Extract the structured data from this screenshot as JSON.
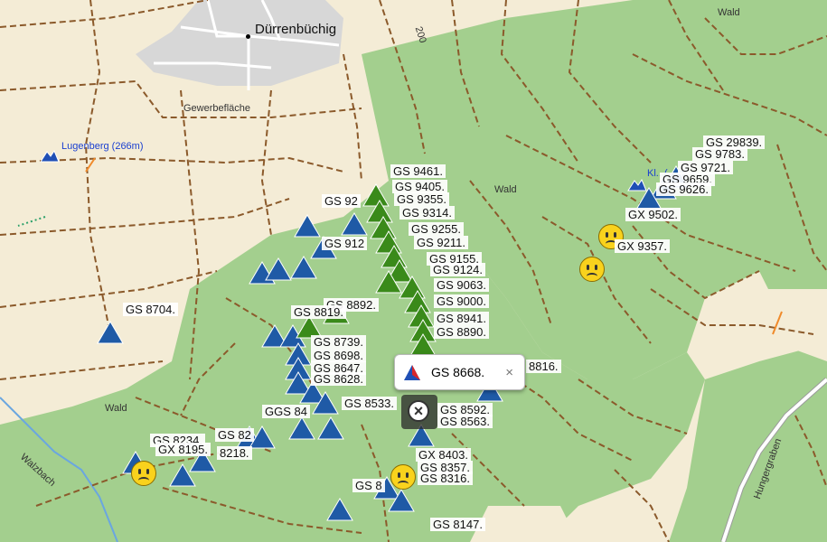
{
  "map": {
    "places": {
      "village": "Dürrenbüchig",
      "industrial": "Gewerbefläche",
      "wald_1": "Wald",
      "wald_2": "Wald",
      "wald_3": "Wald",
      "stream": "Walzbach",
      "road": "Hungergraben",
      "contour": "200",
      "peak": "Lugenberg (266m)",
      "peak2": "Kl...(...m)"
    },
    "labels": {
      "gs9461": "GS 9461.",
      "gs9405": "GS 9405.",
      "gs9355": "GS 9355.",
      "gs9314": "GS 9314.",
      "gs92xx": "GS 92",
      "gs9255": "GS 9255.",
      "gs9211": "GS 9211.",
      "gs912x": "GS 912",
      "gs9155": "GS 9155.",
      "gs9124": "GS 9124.",
      "gs9063": "GS 9063.",
      "gs9000": "GS 9000.",
      "gs8941": "GS 8941.",
      "gs8890": "GS 8890.",
      "gs8892": "GS 8892.",
      "gs8819": "GS 8819.",
      "gs8739": "GS 8739.",
      "gs8698": "GS 8698.",
      "gs8647": "GS 8647.",
      "gs8628": "GS 8628.",
      "gs8704": "GS 8704.",
      "gs8816": "8816.",
      "gs8533": "GS 8533.",
      "gs8592": "GS 8592.",
      "gs8563": "GS 8563.",
      "gg84": "GGS 84",
      "gs8234": "GS 8234.",
      "gx8195": "GX 8195.",
      "gs8218": "8218.",
      "gs82xx": "GS 82",
      "gx8403": "GX 8403.",
      "gs8357": "GS 8357.",
      "gs8316": "GS 8316.",
      "gs83": "GS 8",
      "gs8147": "GS 8147.",
      "gs29839": "GS 29839.",
      "gs9783": "GS 9783.",
      "gs9721": "GS 9721.",
      "gs9659": "GS 9659.",
      "gs9626": "GS 9626.",
      "gx9502": "GX 9502.",
      "gx9357": "GX 9357."
    }
  },
  "popup": {
    "title": "GS 8668.",
    "close": "×"
  },
  "colors": {
    "background": "#f4ecd6",
    "forest": "#9bc98a",
    "track": "#8b5a2b",
    "poi_blue": "#1f5aa6",
    "poi_green": "#3a8a1a",
    "face": "#f9d21d"
  }
}
